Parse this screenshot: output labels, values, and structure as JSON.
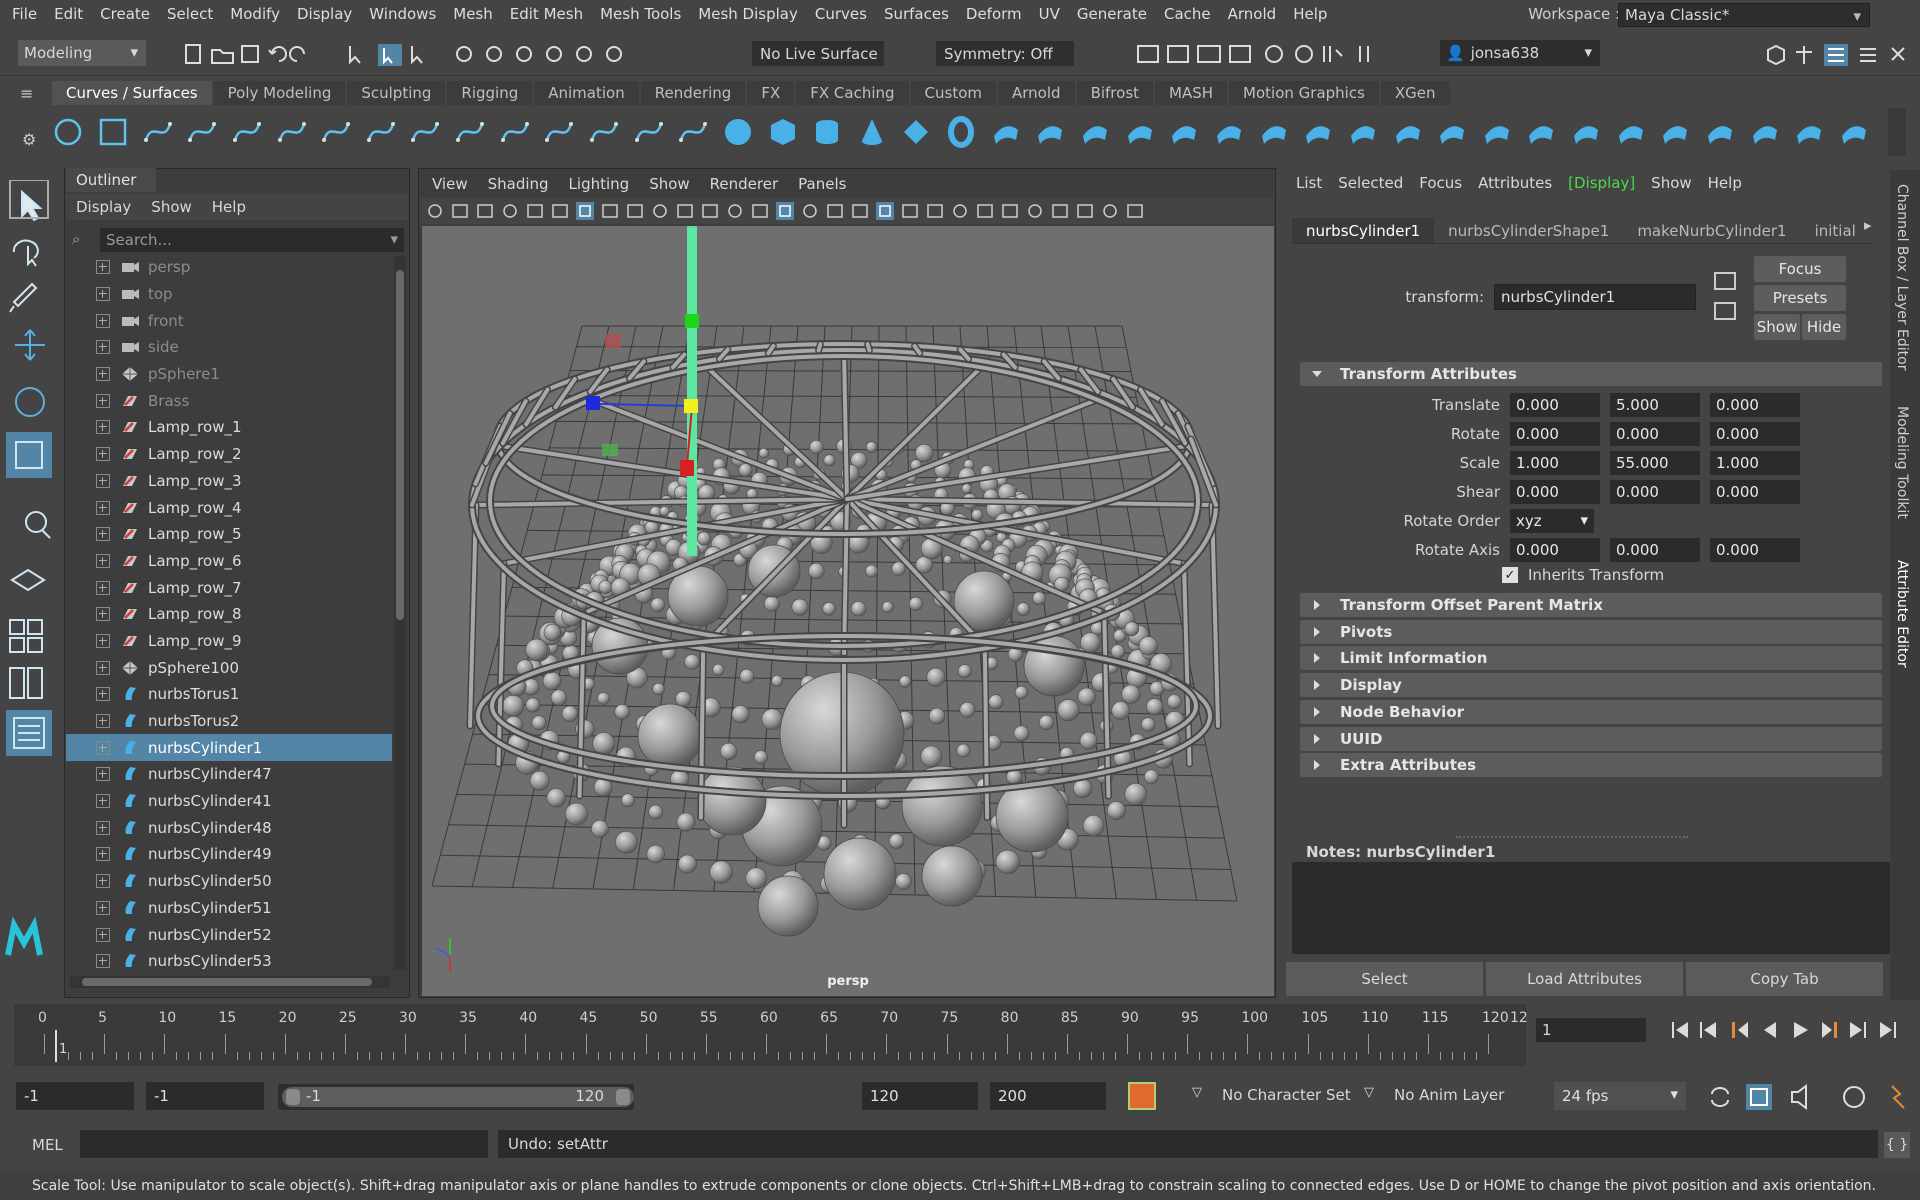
{
  "menubar": {
    "items": [
      "File",
      "Edit",
      "Create",
      "Select",
      "Modify",
      "Display",
      "Windows",
      "Mesh",
      "Edit Mesh",
      "Mesh Tools",
      "Mesh Display",
      "Curves",
      "Surfaces",
      "Deform",
      "UV",
      "Generate",
      "Cache",
      "Arnold",
      "Help"
    ],
    "workspace_label": "Workspace :",
    "workspace_value": "Maya Classic*"
  },
  "statusline": {
    "mode": "Modeling",
    "live_surface": "No Live Surface",
    "symmetry": "Symmetry: Off",
    "user": "jonsa638"
  },
  "shelf": {
    "tabs": [
      "Curves / Surfaces",
      "Poly Modeling",
      "Sculpting",
      "Rigging",
      "Animation",
      "Rendering",
      "FX",
      "FX Caching",
      "Custom",
      "Arnold",
      "Bifrost",
      "MASH",
      "Motion Graphics",
      "XGen"
    ],
    "active_tab": 0
  },
  "outliner": {
    "title": "Outliner",
    "menu": [
      "Display",
      "Show",
      "Help"
    ],
    "search_placeholder": "Search...",
    "items": [
      {
        "label": "persp",
        "icon": "camera",
        "dim": true
      },
      {
        "label": "top",
        "icon": "camera",
        "dim": true
      },
      {
        "label": "front",
        "icon": "camera",
        "dim": true
      },
      {
        "label": "side",
        "icon": "camera",
        "dim": true
      },
      {
        "label": "pSphere1",
        "icon": "mesh",
        "dim": true
      },
      {
        "label": "Brass",
        "icon": "group",
        "dim": true
      },
      {
        "label": "Lamp_row_1",
        "icon": "group"
      },
      {
        "label": "Lamp_row_2",
        "icon": "group"
      },
      {
        "label": "Lamp_row_3",
        "icon": "group"
      },
      {
        "label": "Lamp_row_4",
        "icon": "group"
      },
      {
        "label": "Lamp_row_5",
        "icon": "group"
      },
      {
        "label": "Lamp_row_6",
        "icon": "group"
      },
      {
        "label": "Lamp_row_7",
        "icon": "group"
      },
      {
        "label": "Lamp_row_8",
        "icon": "group"
      },
      {
        "label": "Lamp_row_9",
        "icon": "group"
      },
      {
        "label": "pSphere100",
        "icon": "mesh"
      },
      {
        "label": "nurbsTorus1",
        "icon": "nurbs"
      },
      {
        "label": "nurbsTorus2",
        "icon": "nurbs"
      },
      {
        "label": "nurbsCylinder1",
        "icon": "nurbs",
        "selected": true
      },
      {
        "label": "nurbsCylinder47",
        "icon": "nurbs"
      },
      {
        "label": "nurbsCylinder41",
        "icon": "nurbs"
      },
      {
        "label": "nurbsCylinder48",
        "icon": "nurbs"
      },
      {
        "label": "nurbsCylinder49",
        "icon": "nurbs"
      },
      {
        "label": "nurbsCylinder50",
        "icon": "nurbs"
      },
      {
        "label": "nurbsCylinder51",
        "icon": "nurbs"
      },
      {
        "label": "nurbsCylinder52",
        "icon": "nurbs"
      },
      {
        "label": "nurbsCylinder53",
        "icon": "nurbs"
      }
    ]
  },
  "viewport": {
    "menu": [
      "View",
      "Shading",
      "Lighting",
      "Show",
      "Renderer",
      "Panels"
    ],
    "camera": "persp"
  },
  "attribute_editor": {
    "menu": [
      "List",
      "Selected",
      "Focus",
      "Attributes",
      "[Display]",
      "Show",
      "Help"
    ],
    "tabs": [
      "nurbsCylinder1",
      "nurbsCylinderShape1",
      "makeNurbCylinder1",
      "initial"
    ],
    "transform_label": "transform:",
    "transform_value": "nurbsCylinder1",
    "focus": "Focus",
    "presets": "Presets",
    "show": "Show",
    "hide": "Hide",
    "transform_section": "Transform Attributes",
    "attrs": [
      {
        "label": "Translate",
        "values": [
          "0.000",
          "5.000",
          "0.000"
        ]
      },
      {
        "label": "Rotate",
        "values": [
          "0.000",
          "0.000",
          "0.000"
        ]
      },
      {
        "label": "Scale",
        "values": [
          "1.000",
          "55.000",
          "1.000"
        ]
      },
      {
        "label": "Shear",
        "values": [
          "0.000",
          "0.000",
          "0.000"
        ]
      }
    ],
    "rotate_order_label": "Rotate Order",
    "rotate_order": "xyz",
    "rotate_axis": {
      "label": "Rotate Axis",
      "values": [
        "0.000",
        "0.000",
        "0.000"
      ]
    },
    "inherits_transform": "Inherits Transform",
    "sections": [
      "Transform Offset Parent Matrix",
      "Pivots",
      "Limit Information",
      "Display",
      "Node Behavior",
      "UUID",
      "Extra Attributes"
    ],
    "notes_label": "Notes:  nurbsCylinder1",
    "bottom_buttons": [
      "Select",
      "Load Attributes",
      "Copy Tab"
    ]
  },
  "side_tabs": [
    "Channel Box / Layer Editor",
    "Modeling Toolkit",
    "Attribute Editor"
  ],
  "timeslider": {
    "ticks": [
      0,
      5,
      10,
      15,
      20,
      25,
      30,
      35,
      40,
      45,
      50,
      55,
      60,
      65,
      70,
      75,
      80,
      85,
      90,
      95,
      100,
      105,
      110,
      115,
      120
    ],
    "end_label": "12",
    "current_marker": "1",
    "current_frame": "1"
  },
  "range": {
    "start": "-1",
    "playback_start": "-1",
    "slider_start": "-1",
    "slider_end": "120",
    "playback_end": "120",
    "end": "200",
    "character_set": "No Character Set",
    "anim_layer": "No Anim Layer",
    "fps": "24 fps"
  },
  "cmdline": {
    "label": "MEL",
    "result": "Undo: setAttr"
  },
  "helpline": "Scale Tool: Use manipulator to scale object(s). Shift+drag manipulator axis or plane handles to extrude components or clone objects. Ctrl+Shift+LMB+drag to constrain scaling to connected edges. Use D or HOME to change the pivot position and axis orientation.",
  "colors": {
    "selection": "#5285a6",
    "accent_green": "#4cd94c",
    "maya_logo": "#29c3d9"
  }
}
